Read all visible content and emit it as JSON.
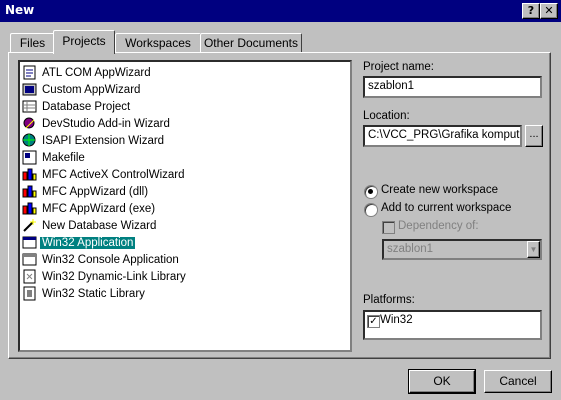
{
  "window": {
    "title": "New",
    "help": "?",
    "close": "✕"
  },
  "tabs": [
    "Files",
    "Projects",
    "Workspaces",
    "Other Documents"
  ],
  "projects": [
    "ATL COM AppWizard",
    "Custom AppWizard",
    "Database Project",
    "DevStudio Add-in Wizard",
    "ISAPI Extension Wizard",
    "Makefile",
    "MFC ActiveX ControlWizard",
    "MFC AppWizard (dll)",
    "MFC AppWizard (exe)",
    "New Database Wizard",
    "Win32 Application",
    "Win32 Console Application",
    "Win32 Dynamic-Link Library",
    "Win32 Static Library"
  ],
  "selected_project": "Win32 Application",
  "project_name": {
    "label": "Project name:",
    "value": "szablon1"
  },
  "location": {
    "label": "Location:",
    "value": "C:\\VCC_PRG\\Grafika komputerowa",
    "browse": "..."
  },
  "workspace": {
    "create": "Create new workspace",
    "add": "Add to current workspace",
    "dependency": "Dependency of:",
    "dependency_value": "szablon1",
    "arrow": "▼"
  },
  "platforms": {
    "label": "Platforms:",
    "items": [
      {
        "name": "Win32",
        "checked": true
      }
    ],
    "check": "✓"
  },
  "buttons": {
    "ok": "OK",
    "cancel": "Cancel"
  },
  "colors": {
    "titlebar": "#000080",
    "selection": "#008080",
    "face": "#c0c0c0"
  }
}
